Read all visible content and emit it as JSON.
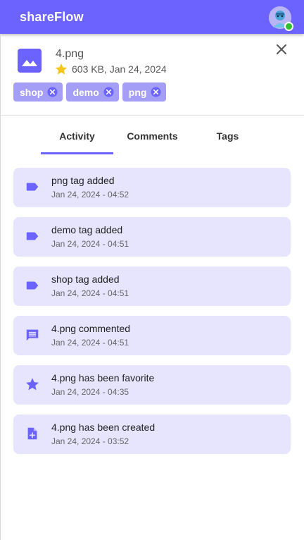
{
  "app": {
    "title": "shareFlow"
  },
  "file": {
    "name": "4.png",
    "meta": "603 KB, Jan 24, 2024",
    "favorite": true
  },
  "tags": [
    {
      "label": "shop"
    },
    {
      "label": "demo"
    },
    {
      "label": "png"
    }
  ],
  "tabs": [
    {
      "label": "Activity",
      "selected": true
    },
    {
      "label": "Comments",
      "selected": false
    },
    {
      "label": "Tags",
      "selected": false
    }
  ],
  "activity": [
    {
      "icon": "tag-icon",
      "title": "png tag added",
      "time": "Jan 24, 2024 - 04:52"
    },
    {
      "icon": "tag-icon",
      "title": "demo tag added",
      "time": "Jan 24, 2024 - 04:51"
    },
    {
      "icon": "tag-icon",
      "title": "shop tag added",
      "time": "Jan 24, 2024 - 04:51"
    },
    {
      "icon": "comment-icon",
      "title": "4.png commented",
      "time": "Jan 24, 2024 - 04:51"
    },
    {
      "icon": "star-icon",
      "title": "4.png has been favorite",
      "time": "Jan 24, 2024 - 04:35"
    },
    {
      "icon": "file-add-icon",
      "title": "4.png has been created",
      "time": "Jan 24, 2024 - 03:52"
    }
  ],
  "colors": {
    "primary": "#6c63ff",
    "chip": "#a49ef7",
    "activity_card": "#e6e5fd",
    "favorite_star": "#f5c518",
    "online": "#2fbf2f"
  }
}
